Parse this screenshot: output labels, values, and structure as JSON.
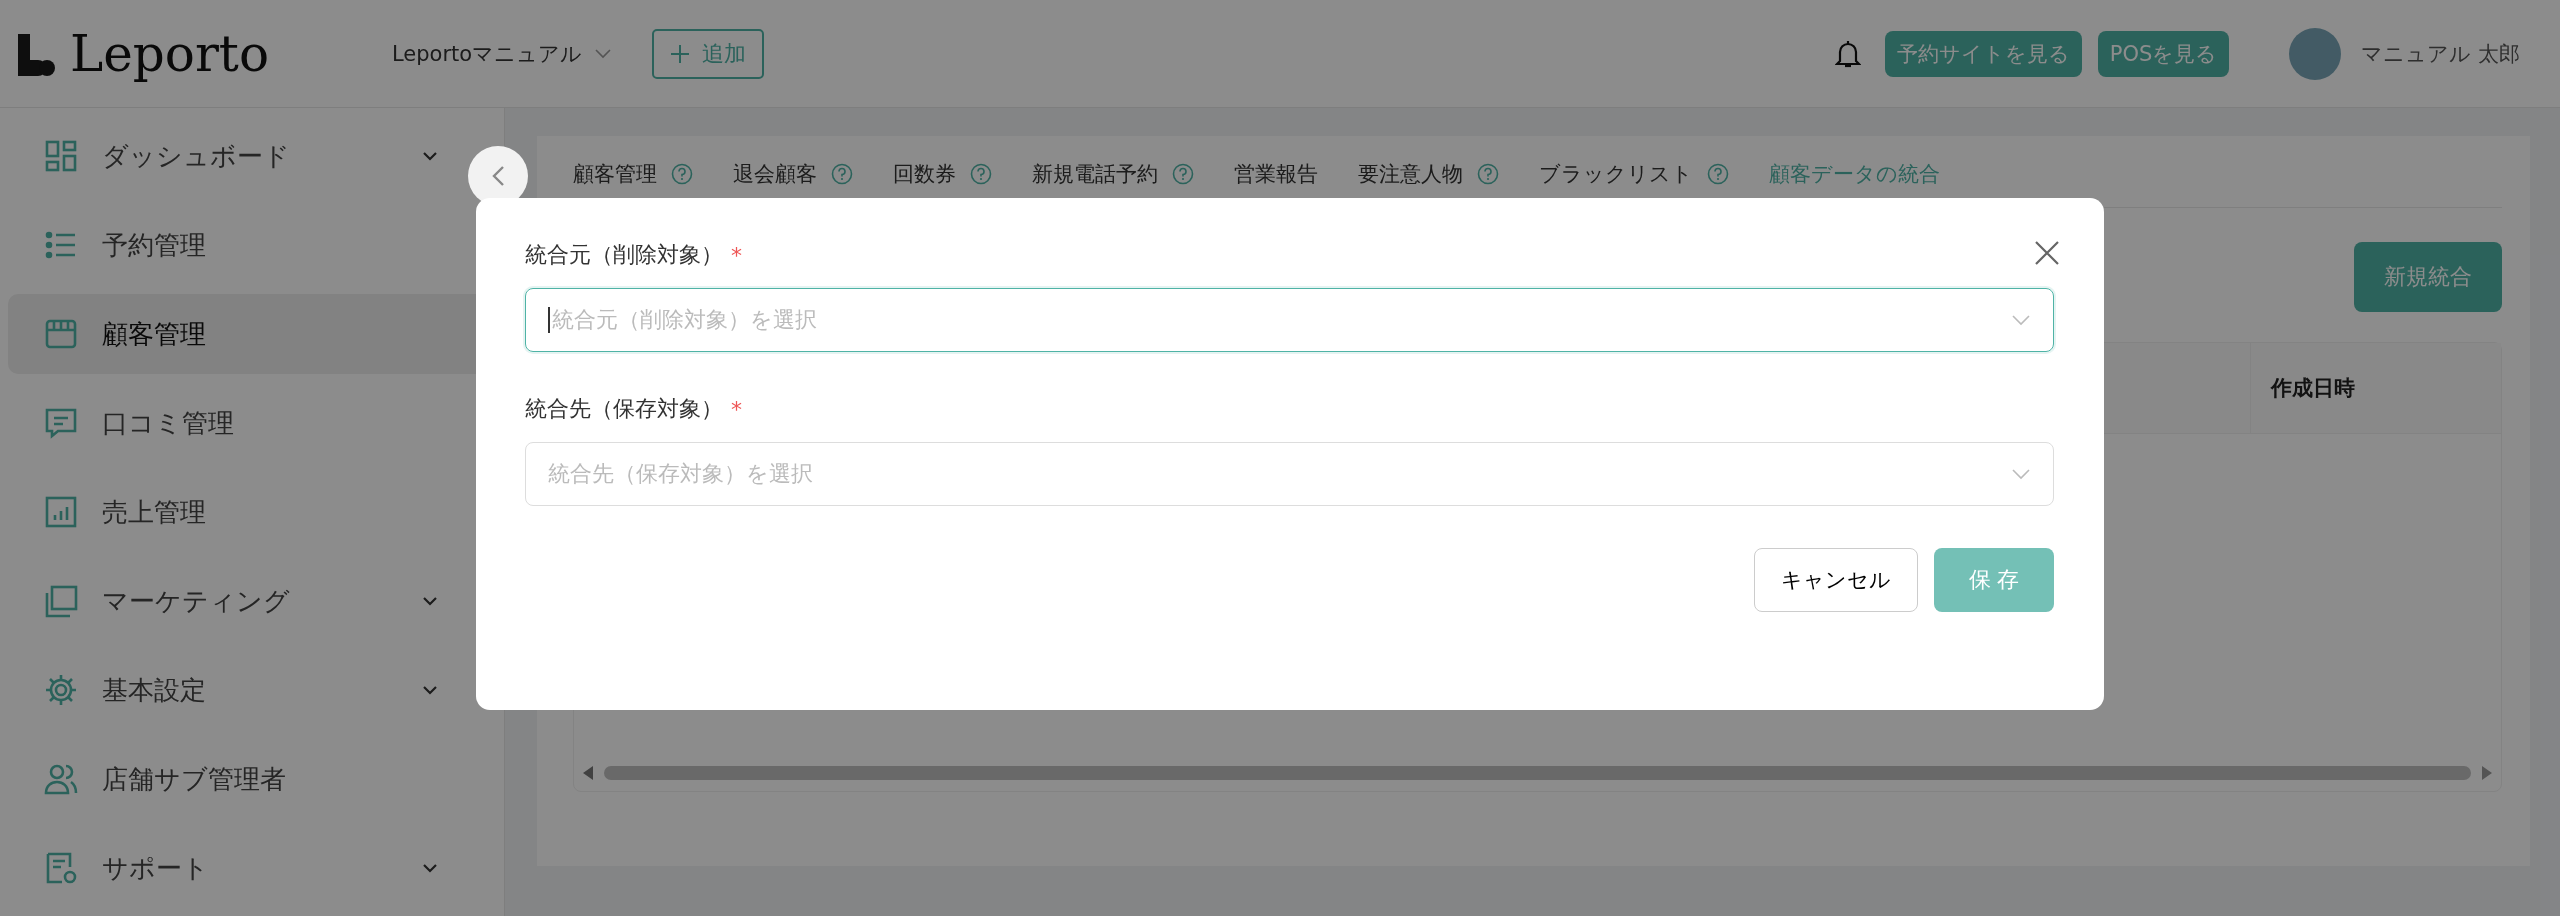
{
  "header": {
    "logo": "Leporto",
    "store_selector": "Leportoマニュアル",
    "add_button": "追加",
    "links": [
      "予約サイトを見る",
      "POSを見る"
    ],
    "user_name": "マニュアル 太郎"
  },
  "sidebar": {
    "items": [
      {
        "label": "ダッシュボード",
        "selected": false,
        "expandable": true
      },
      {
        "label": "予約管理",
        "selected": false,
        "expandable": false
      },
      {
        "label": "顧客管理",
        "selected": true,
        "expandable": false
      },
      {
        "label": "口コミ管理",
        "selected": false,
        "expandable": false
      },
      {
        "label": "売上管理",
        "selected": false,
        "expandable": false
      },
      {
        "label": "マーケティング",
        "selected": false,
        "expandable": true
      },
      {
        "label": "基本設定",
        "selected": false,
        "expandable": true
      },
      {
        "label": "店舗サブ管理者",
        "selected": false,
        "expandable": false
      },
      {
        "label": "サポート",
        "selected": false,
        "expandable": true
      }
    ]
  },
  "tabs": [
    {
      "label": "顧客管理",
      "help": true,
      "selected": false
    },
    {
      "label": "退会顧客",
      "help": true,
      "selected": false
    },
    {
      "label": "回数券",
      "help": true,
      "selected": false
    },
    {
      "label": "新規電話予約",
      "help": true,
      "selected": false
    },
    {
      "label": "営業報告",
      "help": false,
      "selected": false
    },
    {
      "label": "要注意人物",
      "help": true,
      "selected": false
    },
    {
      "label": "ブラックリスト",
      "help": true,
      "selected": false
    },
    {
      "label": "顧客データの統合",
      "help": false,
      "selected": true
    }
  ],
  "action_button": "新規統合",
  "table": {
    "columns": [
      {
        "label": "作成日時"
      }
    ]
  },
  "modal": {
    "fields": [
      {
        "label": "統合元（削除対象）",
        "required_mark": "*",
        "placeholder": "統合元（削除対象）を選択",
        "focused": true
      },
      {
        "label": "統合先（保存対象）",
        "required_mark": "*",
        "placeholder": "統合先（保存対象）を選択",
        "focused": false
      }
    ],
    "cancel_button": "キャンセル",
    "save_button": "保 存"
  }
}
